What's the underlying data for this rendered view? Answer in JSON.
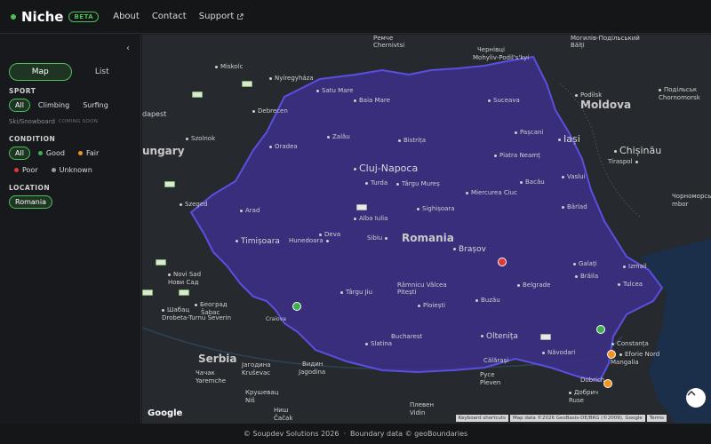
{
  "header": {
    "brand": "Niche",
    "badge": "BETA",
    "nav": {
      "about": "About",
      "contact": "Contact",
      "support": "Support"
    }
  },
  "sidebar": {
    "collapse_label": "‹",
    "view_toggle": {
      "map": "Map",
      "list": "List",
      "selected": "Map"
    },
    "sport": {
      "title": "SPORT",
      "options": [
        "All",
        "Climbing",
        "Surfing"
      ],
      "selected": "All",
      "disabled_option": "Ski/Snowboard",
      "disabled_note": "COMING SOON"
    },
    "condition": {
      "title": "CONDITION",
      "options": [
        {
          "label": "All"
        },
        {
          "label": "Good",
          "color": "#3fae4f"
        },
        {
          "label": "Fair",
          "color": "#f0941e"
        },
        {
          "label": "Poor",
          "color": "#e0383a"
        },
        {
          "label": "Unknown",
          "color": "#9a9a9a"
        }
      ],
      "selected": "All"
    },
    "location": {
      "title": "LOCATION",
      "selected": "Romania"
    }
  },
  "map": {
    "highlight_color": "#3c2f88",
    "border_color": "#5b4fe0",
    "labels": {
      "country_main": "Romania",
      "moldova": "Moldova",
      "hungary": "ungary",
      "serbia": "Serbia",
      "budapest": "dapest",
      "cities": [
        "Miskolc",
        "Nyíregyháza",
        "Satu Mare",
        "Baia Mare",
        "Debrecen",
        "Szolnok",
        "Oradea",
        "Zalău",
        "Bistrița",
        "Suceava",
        "Pașcani",
        "Iași",
        "Chișinău",
        "Tiraspol",
        "Piatra Neamț",
        "Cluj-Napoca",
        "Turda",
        "Târgu Mureș",
        "Miercurea Ciuc",
        "Bacău",
        "Vaslui",
        "Bârlad",
        "Arad",
        "Timișoara",
        "Alba Iulia",
        "Sighișoara",
        "Deva",
        "Hunedoara",
        "Sibiu",
        "Brașov",
        "Galați",
        "Brăila",
        "Tulcea",
        "Izmail",
        "Szeged",
        "Novi Sad",
        "Нови Сад",
        "Târgu Jiu",
        "Râmnicu Vâlcea",
        "Pitești",
        "Ploiești",
        "Buzău",
        "Belgrade",
        "Београд",
        "Šabac",
        "Шабац",
        "Drobeta-Turnu Severin",
        "Craiova",
        "Slatina",
        "Bucharest",
        "Oltenița",
        "Călărași",
        "Năvodari",
        "Constanța",
        "Eforie Nord",
        "Mangalia",
        "Dobrich",
        "Добрич",
        "Ruse",
        "Русе",
        "Pleven",
        "Плевен",
        "Vidin",
        "Видин",
        "Jagodina",
        "Јагодина",
        "Kruševac",
        "Крушевац",
        "Niš",
        "Ниш",
        "Čačak",
        "Чачак",
        "Yaremche",
        "Ремче",
        "Chernivtsi",
        "Чернівці",
        "Mohyliv-Podil's'kyi",
        "Могилів-Подільський",
        "Bălți",
        "Podilsk",
        "Подільськ",
        "Chornomorsk",
        "Чорноморськ",
        "mbor"
      ]
    },
    "markers": [
      {
        "condition": "Poor",
        "color": "#e0383a"
      },
      {
        "condition": "Good",
        "color": "#3fae4f"
      },
      {
        "condition": "Good",
        "color": "#3fae4f"
      },
      {
        "condition": "Fair",
        "color": "#f0941e"
      },
      {
        "condition": "Fair",
        "color": "#f0941e"
      }
    ],
    "google_logo": "Google",
    "attribution": {
      "shortcuts": "Keyboard shortcuts",
      "data": "Map data ©2026 GeoBasis-DE/BKG (©2009), Google",
      "terms": "Terms"
    }
  },
  "footer": {
    "copyright": "© Soupdev Solutions 2026",
    "separator": "·",
    "boundary": "Boundary data © geoBoundaries"
  }
}
